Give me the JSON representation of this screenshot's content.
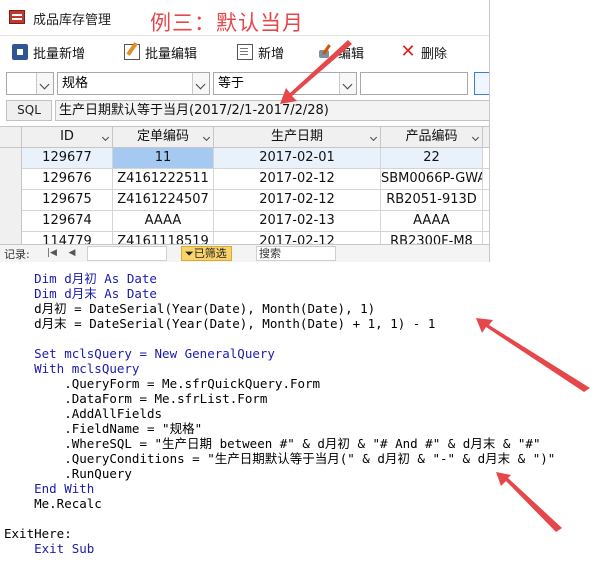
{
  "window": {
    "tab_title": "成品库存管理",
    "annotation": "例三：默认当月"
  },
  "toolbar": {
    "batch_add": "批量新增",
    "batch_edit": "批量编辑",
    "add": "新增",
    "edit": "编辑",
    "delete": "删除"
  },
  "filter": {
    "field_value": "规格",
    "operator_value": "等于"
  },
  "sql": {
    "label": "SQL",
    "text": "生产日期默认等于当月(2017/2/1-2017/2/28)"
  },
  "grid": {
    "columns": [
      "ID",
      "定单编码",
      "生产日期",
      "产品编码"
    ],
    "rows": [
      [
        "129677",
        "11",
        "2017-02-01",
        "22"
      ],
      [
        "129676",
        "Z4161222511",
        "2017-02-12",
        "SBM0066P-GWA"
      ],
      [
        "129675",
        "Z4161224507",
        "2017-02-12",
        "RB2051-913D"
      ],
      [
        "129674",
        "AAAA",
        "2017-02-13",
        "AAAA"
      ],
      [
        "114779",
        "Z4161118519",
        "2017-02-12",
        "RB2300F-M8"
      ]
    ]
  },
  "navigation": {
    "record_label": "记录:",
    "first": "|◀",
    "prev": "◀",
    "filter_badge": "已筛选",
    "search_placeholder": "搜索"
  },
  "code": {
    "lines": [
      "    Dim d月初 As Date",
      "    Dim d月末 As Date",
      "    d月初 = DateSerial(Year(Date), Month(Date), 1)",
      "    d月末 = DateSerial(Year(Date), Month(Date) + 1, 1) - 1",
      "",
      "    Set mclsQuery = New GeneralQuery",
      "    With mclsQuery",
      "        .QueryForm = Me.sfrQuickQuery.Form",
      "        .DataForm = Me.sfrList.Form",
      "        .AddAllFields",
      "        .FieldName = \"规格\"",
      "        .WhereSQL = \"生产日期 between #\" & d月初 & \"# And #\" & d月末 & \"#\"",
      "        .QueryConditions = \"生产日期默认等于当月(\" & d月初 & \"-\" & d月末 & \")\"",
      "        .RunQuery",
      "    End With",
      "    Me.Recalc",
      "",
      "ExitHere:",
      "    Exit Sub"
    ]
  },
  "colors": {
    "annotation_red": "#e5474a",
    "selected_cell": "#a6c9f1",
    "keyword_blue": "#1b1bb0",
    "filter_badge": "#f8d36a"
  }
}
